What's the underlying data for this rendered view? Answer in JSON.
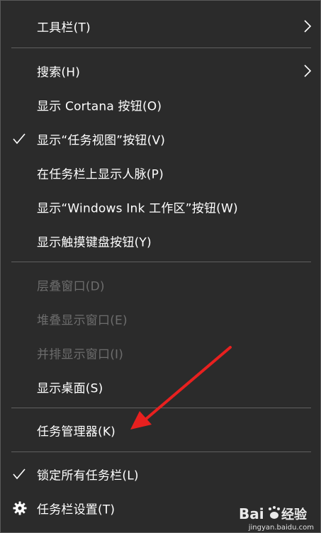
{
  "menu": {
    "items": [
      {
        "label": "工具栏(T)"
      },
      {
        "label": "搜索(H)"
      },
      {
        "label": "显示 Cortana 按钮(O)"
      },
      {
        "label": "显示“任务视图”按钮(V)"
      },
      {
        "label": "在任务栏上显示人脉(P)"
      },
      {
        "label": "显示“Windows Ink 工作区”按钮(W)"
      },
      {
        "label": "显示触摸键盘按钮(Y)"
      },
      {
        "label": "层叠窗口(D)"
      },
      {
        "label": "堆叠显示窗口(E)"
      },
      {
        "label": "并排显示窗口(I)"
      },
      {
        "label": "显示桌面(S)"
      },
      {
        "label": "任务管理器(K)"
      },
      {
        "label": "锁定所有任务栏(L)"
      },
      {
        "label": "任务栏设置(T)"
      }
    ]
  },
  "icons": {
    "check": "check-icon",
    "submenu": "chevron-right-icon",
    "settings": "gear-icon"
  },
  "colors": {
    "background": "#2b2b2b",
    "text": "#ffffff",
    "disabled_text": "#6d6d6d",
    "separator": "#5f5f5f",
    "annotation_arrow": "#e8201f"
  },
  "watermark": {
    "subtext": "jingyan.baidu.com"
  }
}
